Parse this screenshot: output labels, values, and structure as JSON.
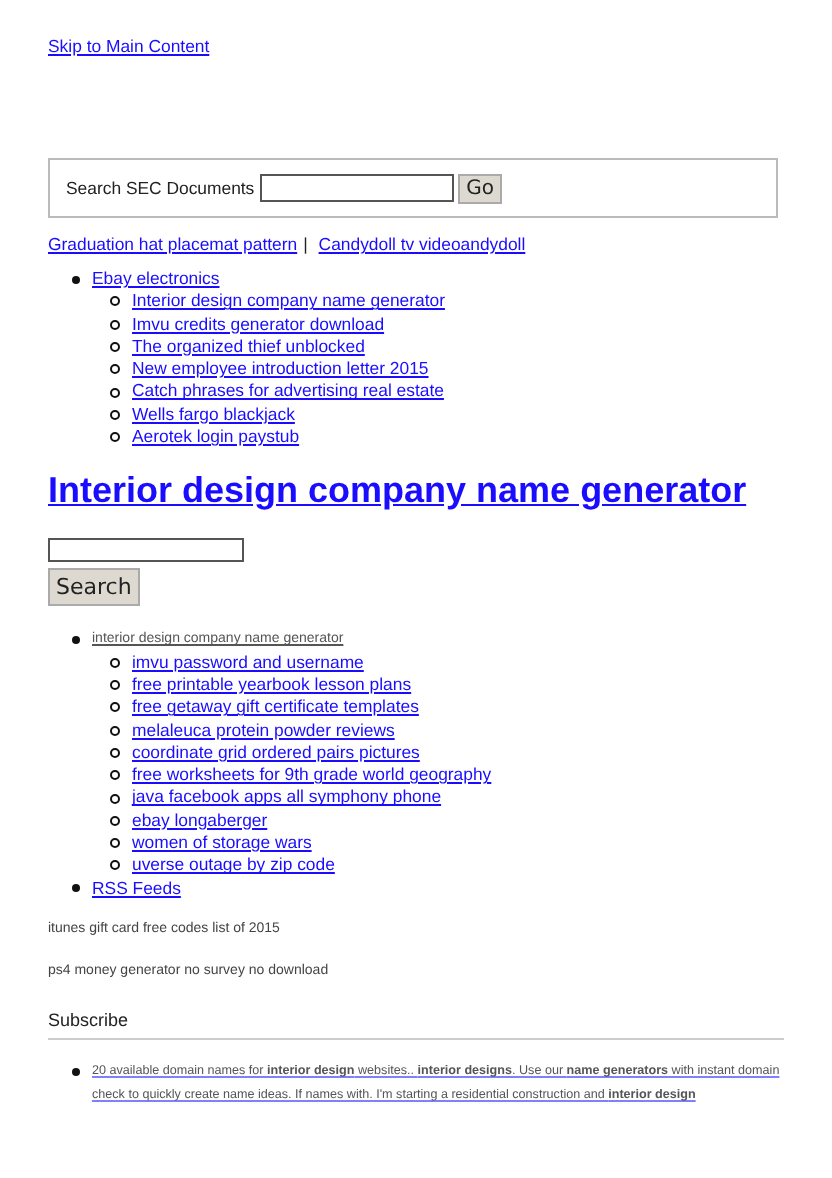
{
  "skip_link": "Skip to Main Content",
  "sec_search": {
    "label": "Search SEC Documents",
    "button": "Go"
  },
  "top_links": [
    "Graduation hat placemat pattern",
    "Candydoll tv videoandydoll"
  ],
  "top_separator": "|",
  "nav": {
    "label": "Ebay electronics",
    "children": [
      "Interior design company name generator",
      "Imvu credits generator download",
      "The organized thief unblocked",
      "New employee introduction letter 2015",
      "Catch phrases for advertising real estate",
      "Wells fargo blackjack",
      "Aerotek login paystub"
    ]
  },
  "heading": "Interior design company name generator",
  "search": {
    "button": "Search"
  },
  "list": {
    "label": "interior design company name generator",
    "children": [
      "imvu password and username",
      "free printable yearbook lesson plans",
      "free getaway gift certificate templates",
      "melaleuca protein powder reviews",
      "coordinate grid ordered pairs pictures",
      "free worksheets for 9th grade world geography",
      "java facebook apps all symphony phone",
      "ebay longaberger",
      "women of storage wars",
      "uverse outage by zip code"
    ]
  },
  "rss": "RSS Feeds",
  "notes": [
    "itunes gift card free codes list of 2015",
    "ps4 money generator no survey no download"
  ],
  "subscribe": "Subscribe",
  "results": [
    "20 available domain names for **interior design** websites.. **interior designs**. Use our **name generators** with instant domain check to quickly create name ideas. If names with. I'm starting a residential construction and **interior design**"
  ]
}
